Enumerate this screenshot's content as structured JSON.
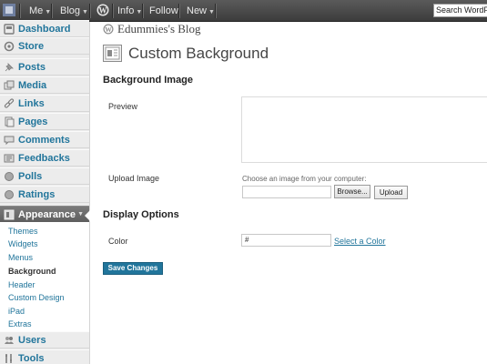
{
  "adminbar": {
    "me_label": "Me",
    "blog_label": "Blog",
    "info_label": "Info",
    "follow_label": "Follow",
    "new_label": "New",
    "search_placeholder": "Search WordPress"
  },
  "sidebar": {
    "items": [
      {
        "label": "Dashboard",
        "icon": "dashboard-icon"
      },
      {
        "label": "Store",
        "icon": "store-icon"
      },
      {
        "label": "Posts",
        "icon": "pin-icon"
      },
      {
        "label": "Media",
        "icon": "media-icon"
      },
      {
        "label": "Links",
        "icon": "link-icon"
      },
      {
        "label": "Pages",
        "icon": "pages-icon"
      },
      {
        "label": "Comments",
        "icon": "comment-icon"
      },
      {
        "label": "Feedbacks",
        "icon": "feedback-icon"
      },
      {
        "label": "Polls",
        "icon": "poll-icon"
      },
      {
        "label": "Ratings",
        "icon": "rating-icon"
      },
      {
        "label": "Appearance",
        "icon": "appearance-icon"
      },
      {
        "label": "Users",
        "icon": "users-icon"
      },
      {
        "label": "Tools",
        "icon": "tools-icon"
      }
    ],
    "submenu": [
      {
        "label": "Themes"
      },
      {
        "label": "Widgets"
      },
      {
        "label": "Menus"
      },
      {
        "label": "Background",
        "current": true
      },
      {
        "label": "Header"
      },
      {
        "label": "Custom Design"
      },
      {
        "label": "iPad"
      },
      {
        "label": "Extras"
      }
    ]
  },
  "main": {
    "blog_name": "Edummies's Blog",
    "page_title": "Custom Background",
    "background_image": {
      "heading": "Background Image",
      "preview_label": "Preview",
      "upload_label": "Upload Image",
      "choose_text": "Choose an image from your computer:",
      "browse_label": "Browse...",
      "upload_button": "Upload"
    },
    "display_options": {
      "heading": "Display Options",
      "color_label": "Color",
      "color_value": "#",
      "select_color_link": "Select a Color"
    },
    "save_button": "Save Changes"
  },
  "colors": {
    "admin_bar": "#464646",
    "link_blue": "#21759b",
    "primary_button": "#21759b",
    "current_menu": "#6d6d6d"
  }
}
